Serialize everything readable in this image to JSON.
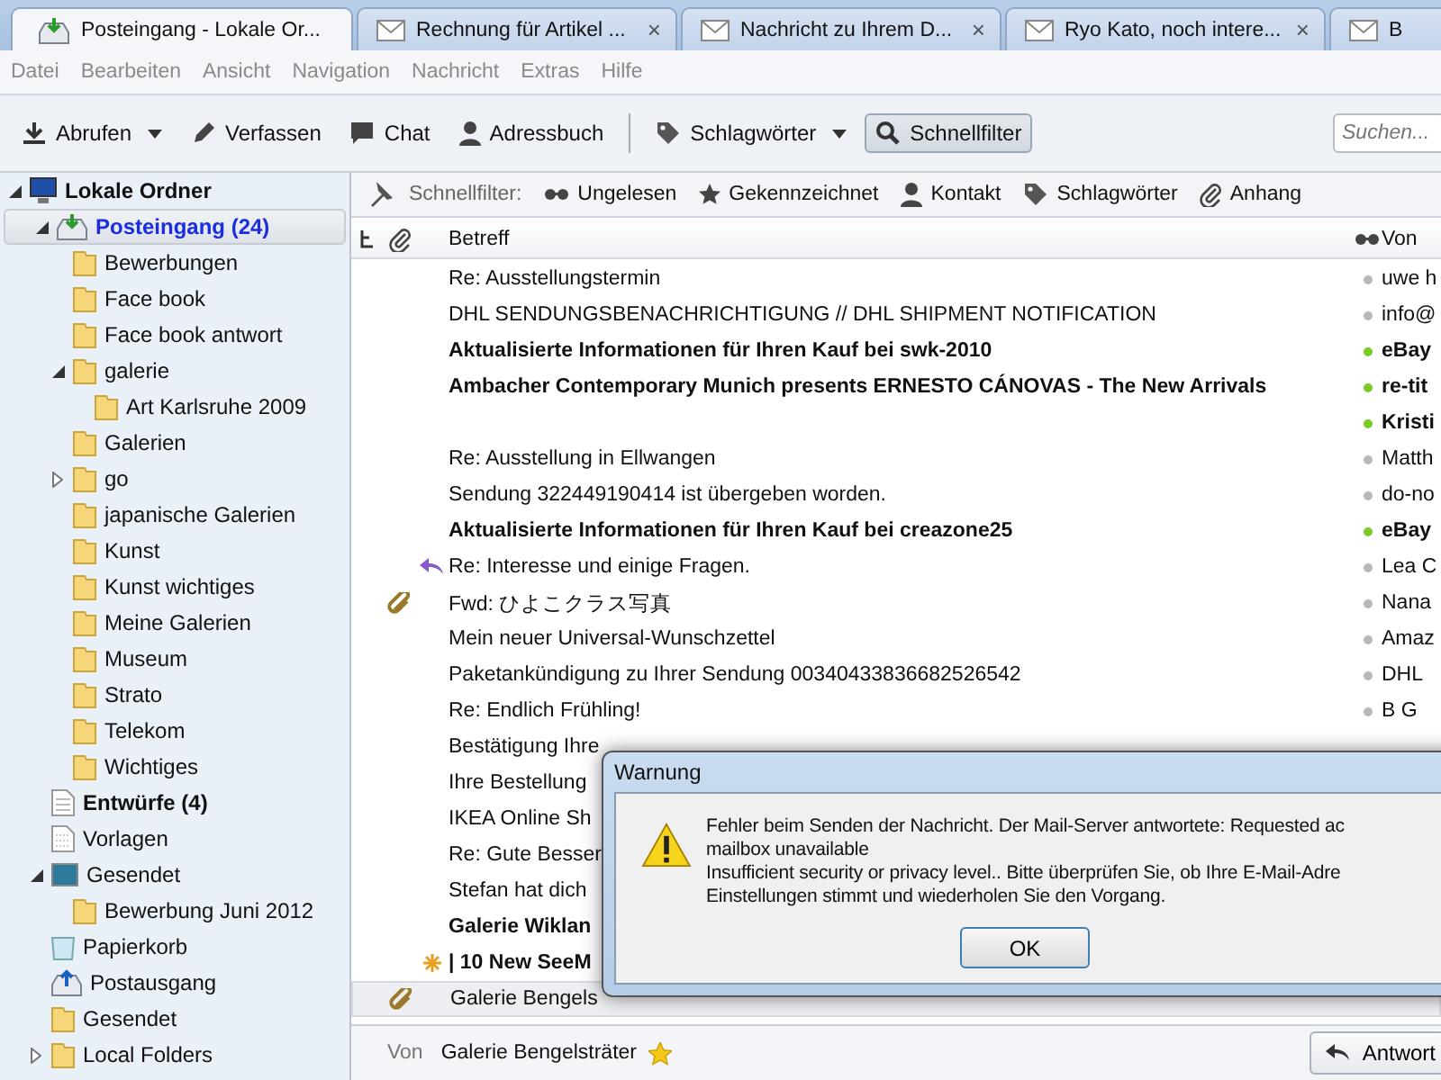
{
  "tabs": [
    {
      "label": "Posteingang - Lokale Or...",
      "kind": "inbox",
      "selected": true,
      "closable": false
    },
    {
      "label": "Rechnung für Artikel ...",
      "kind": "mail",
      "selected": false,
      "closable": true
    },
    {
      "label": "Nachricht zu Ihrem D...",
      "kind": "mail",
      "selected": false,
      "closable": true
    },
    {
      "label": "Ryo Kato, noch intere...",
      "kind": "mail",
      "selected": false,
      "closable": true
    },
    {
      "label": "B",
      "kind": "mail",
      "selected": false,
      "closable": false
    }
  ],
  "close_glyph": "×",
  "menu": [
    "Datei",
    "Bearbeiten",
    "Ansicht",
    "Navigation",
    "Nachricht",
    "Extras",
    "Hilfe"
  ],
  "toolbar": [
    {
      "label": "Abrufen",
      "kind": "download",
      "dropdown": true,
      "selected": false
    },
    {
      "label": "Verfassen",
      "kind": "pen",
      "dropdown": false,
      "selected": false
    },
    {
      "label": "Chat",
      "kind": "chat",
      "dropdown": false,
      "selected": false
    },
    {
      "label": "Adressbuch",
      "kind": "person",
      "dropdown": false,
      "selected": false
    },
    {
      "label": "Schlagwörter",
      "kind": "tag",
      "dropdown": true,
      "selected": false
    },
    {
      "label": "Schnellfilter",
      "kind": "search",
      "dropdown": false,
      "selected": true
    }
  ],
  "search": {
    "placeholder": "Suchen..."
  },
  "folders": [
    {
      "label": "Lokale Ordner",
      "kind": "computer",
      "selected": false,
      "unread": true,
      "expanded": true,
      "children": [
        {
          "label": "Posteingang (24)",
          "kind": "inbox",
          "selected": true,
          "unread": true,
          "expanded": true,
          "children": [
            {
              "label": "Bewerbungen",
              "kind": "folder",
              "selected": false,
              "unread": false
            },
            {
              "label": "Face book",
              "kind": "folder",
              "selected": false,
              "unread": false
            },
            {
              "label": "Face book antwort",
              "kind": "folder",
              "selected": false,
              "unread": false
            },
            {
              "label": "galerie",
              "kind": "folder",
              "selected": false,
              "unread": false,
              "expanded": true,
              "children": [
                {
                  "label": "Art Karlsruhe 2009",
                  "kind": "folder",
                  "selected": false,
                  "unread": false
                }
              ]
            },
            {
              "label": "Galerien",
              "kind": "folder",
              "selected": false,
              "unread": false
            },
            {
              "label": "go",
              "kind": "folder",
              "selected": false,
              "unread": false,
              "expanded": false
            },
            {
              "label": "japanische Galerien",
              "kind": "folder",
              "selected": false,
              "unread": false
            },
            {
              "label": "Kunst",
              "kind": "folder",
              "selected": false,
              "unread": false
            },
            {
              "label": "Kunst wichtiges",
              "kind": "folder",
              "selected": false,
              "unread": false
            },
            {
              "label": "Meine Galerien",
              "kind": "folder",
              "selected": false,
              "unread": false
            },
            {
              "label": "Museum",
              "kind": "folder",
              "selected": false,
              "unread": false
            },
            {
              "label": "Strato",
              "kind": "folder",
              "selected": false,
              "unread": false
            },
            {
              "label": "Telekom",
              "kind": "folder",
              "selected": false,
              "unread": false
            },
            {
              "label": "Wichtiges",
              "kind": "folder",
              "selected": false,
              "unread": false
            }
          ]
        },
        {
          "label": "Entwürfe (4)",
          "kind": "drafts",
          "selected": false,
          "unread": true
        },
        {
          "label": "Vorlagen",
          "kind": "templates",
          "selected": false,
          "unread": false
        },
        {
          "label": "Gesendet",
          "kind": "sent",
          "selected": false,
          "unread": false,
          "expanded": true,
          "children": [
            {
              "label": "Bewerbung Juni 2012",
              "kind": "folder",
              "selected": false,
              "unread": false
            }
          ]
        },
        {
          "label": "Papierkorb",
          "kind": "trash",
          "selected": false,
          "unread": false
        },
        {
          "label": "Postausgang",
          "kind": "outbox",
          "selected": false,
          "unread": false
        },
        {
          "label": "Gesendet",
          "kind": "folder",
          "selected": false,
          "unread": false
        },
        {
          "label": "Local Folders",
          "kind": "folder",
          "selected": false,
          "unread": false,
          "expanded": false
        }
      ]
    }
  ],
  "quick_filter": {
    "label": "Schnellfilter:",
    "buttons": [
      {
        "label": "Ungelesen",
        "kind": "glasses"
      },
      {
        "label": "Gekennzeichnet",
        "kind": "star"
      },
      {
        "label": "Kontakt",
        "kind": "person"
      },
      {
        "label": "Schlagwörter",
        "kind": "tag"
      },
      {
        "label": "Anhang",
        "kind": "clip"
      }
    ]
  },
  "columns": {
    "subject": "Betreff",
    "sender": "Von"
  },
  "messages": [
    {
      "kind": "plain",
      "subject": "Re: Ausstellungstermin",
      "sender": "uwe h",
      "unread": false,
      "selected": false,
      "attachment": false
    },
    {
      "kind": "plain",
      "subject": "DHL SENDUNGSBENACHRICHTIGUNG // DHL SHIPMENT NOTIFICATION",
      "sender": "info@",
      "unread": false,
      "selected": false,
      "attachment": false
    },
    {
      "kind": "plain",
      "subject": "Aktualisierte Informationen für Ihren Kauf bei swk-2010",
      "sender": "eBay",
      "unread": true,
      "selected": false,
      "attachment": false
    },
    {
      "kind": "plain",
      "subject": "Ambacher Contemporary Munich presents ERNESTO CÁNOVAS - The New Arrivals",
      "sender": "re-tit",
      "unread": true,
      "selected": false,
      "attachment": false
    },
    {
      "kind": "plain",
      "sender": "Kristi",
      "unread": true,
      "selected": false,
      "attachment": false
    },
    {
      "kind": "plain",
      "subject": "Re: Ausstellung in Ellwangen",
      "sender": "Matth",
      "unread": false,
      "selected": false,
      "attachment": false
    },
    {
      "kind": "plain",
      "subject": "Sendung 322449190414 ist übergeben worden.",
      "sender": "do-no",
      "unread": false,
      "selected": false,
      "attachment": false
    },
    {
      "kind": "plain",
      "subject": "Aktualisierte Informationen für Ihren Kauf bei creazone25",
      "sender": "eBay",
      "unread": true,
      "selected": false,
      "attachment": false
    },
    {
      "kind": "replied",
      "subject": "Re: Interesse und einige Fragen.",
      "sender": "Lea C",
      "unread": false,
      "selected": false,
      "attachment": false
    },
    {
      "kind": "plain",
      "subject": "Fwd: ひよこクラス写真",
      "sender": "Nana",
      "unread": false,
      "selected": false,
      "attachment": true
    },
    {
      "kind": "plain",
      "subject": "Mein neuer Universal-Wunschzettel",
      "sender": "Amaz",
      "unread": false,
      "selected": false,
      "attachment": false
    },
    {
      "kind": "plain",
      "subject": "Paketankündigung zu Ihrer Sendung 00340433836682526542",
      "sender": "DHL",
      "unread": false,
      "selected": false,
      "attachment": false
    },
    {
      "kind": "plain",
      "subject": "Re: Endlich Frühling!",
      "sender": "B G",
      "unread": false,
      "selected": false,
      "attachment": false
    },
    {
      "kind": "plain",
      "subject": "Bestätigung Ihre",
      "unread": false,
      "selected": false,
      "attachment": false
    },
    {
      "kind": "plain",
      "subject": "Ihre Bestellung",
      "unread": false,
      "selected": false,
      "attachment": false
    },
    {
      "kind": "plain",
      "subject": "IKEA Online Sh",
      "unread": false,
      "selected": false,
      "attachment": false
    },
    {
      "kind": "plain",
      "subject": "Re: Gute Besser",
      "unread": false,
      "selected": false,
      "attachment": false
    },
    {
      "kind": "plain",
      "subject": "Stefan hat dich",
      "unread": false,
      "selected": false,
      "attachment": false
    },
    {
      "kind": "plain",
      "subject": "Galerie Wiklan",
      "unread": true,
      "selected": false,
      "attachment": false
    },
    {
      "kind": "new",
      "subject": "| 10 New SeeM",
      "unread": true,
      "selected": false,
      "attachment": false
    },
    {
      "kind": "plain",
      "subject": "Galerie Bengels",
      "unread": false,
      "selected": true,
      "attachment": true
    }
  ],
  "preview": {
    "from_label": "Von",
    "from": "Galerie Bengelsträter",
    "starred": true,
    "reply_button": "Antwort"
  },
  "dialog": {
    "title": "Warnung",
    "kind": "warning",
    "lines": [
      "Fehler beim Senden der Nachricht. Der Mail-Server antwortete:  Requested ac",
      "mailbox unavailable",
      "Insufficient security or privacy level.. Bitte überprüfen Sie, ob Ihre E-Mail-Adre",
      "Einstellungen stimmt und wiederholen Sie den Vorgang."
    ],
    "button": "OK"
  }
}
